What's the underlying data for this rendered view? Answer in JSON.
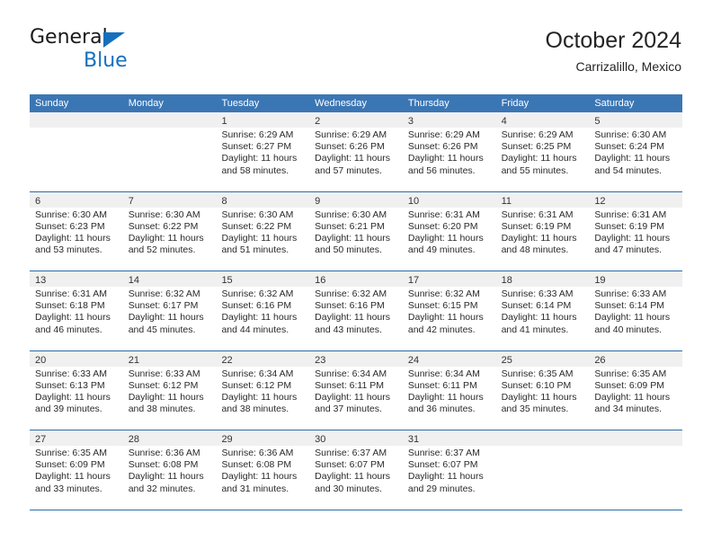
{
  "logo": {
    "word_one": "General",
    "word_two": "Blue",
    "triangle_color": "#1470bd",
    "text_color": "#1a1a1a"
  },
  "header": {
    "title": "October 2024",
    "subtitle": "Carrizalillo, Mexico"
  },
  "theme": {
    "header_blue": "#3b76b4",
    "separator_blue": "#2c6ba8",
    "date_band_gray": "#f0f0f0",
    "page_background": "#ffffff"
  },
  "calendar": {
    "weekdays": [
      "Sunday",
      "Monday",
      "Tuesday",
      "Wednesday",
      "Thursday",
      "Friday",
      "Saturday"
    ],
    "weeks": [
      [
        {
          "date": "",
          "sunrise": "",
          "sunset": "",
          "daylight_line1": "",
          "daylight_line2": ""
        },
        {
          "date": "",
          "sunrise": "",
          "sunset": "",
          "daylight_line1": "",
          "daylight_line2": ""
        },
        {
          "date": "1",
          "sunrise": "Sunrise: 6:29 AM",
          "sunset": "Sunset: 6:27 PM",
          "daylight_line1": "Daylight: 11 hours",
          "daylight_line2": "and 58 minutes."
        },
        {
          "date": "2",
          "sunrise": "Sunrise: 6:29 AM",
          "sunset": "Sunset: 6:26 PM",
          "daylight_line1": "Daylight: 11 hours",
          "daylight_line2": "and 57 minutes."
        },
        {
          "date": "3",
          "sunrise": "Sunrise: 6:29 AM",
          "sunset": "Sunset: 6:26 PM",
          "daylight_line1": "Daylight: 11 hours",
          "daylight_line2": "and 56 minutes."
        },
        {
          "date": "4",
          "sunrise": "Sunrise: 6:29 AM",
          "sunset": "Sunset: 6:25 PM",
          "daylight_line1": "Daylight: 11 hours",
          "daylight_line2": "and 55 minutes."
        },
        {
          "date": "5",
          "sunrise": "Sunrise: 6:30 AM",
          "sunset": "Sunset: 6:24 PM",
          "daylight_line1": "Daylight: 11 hours",
          "daylight_line2": "and 54 minutes."
        }
      ],
      [
        {
          "date": "6",
          "sunrise": "Sunrise: 6:30 AM",
          "sunset": "Sunset: 6:23 PM",
          "daylight_line1": "Daylight: 11 hours",
          "daylight_line2": "and 53 minutes."
        },
        {
          "date": "7",
          "sunrise": "Sunrise: 6:30 AM",
          "sunset": "Sunset: 6:22 PM",
          "daylight_line1": "Daylight: 11 hours",
          "daylight_line2": "and 52 minutes."
        },
        {
          "date": "8",
          "sunrise": "Sunrise: 6:30 AM",
          "sunset": "Sunset: 6:22 PM",
          "daylight_line1": "Daylight: 11 hours",
          "daylight_line2": "and 51 minutes."
        },
        {
          "date": "9",
          "sunrise": "Sunrise: 6:30 AM",
          "sunset": "Sunset: 6:21 PM",
          "daylight_line1": "Daylight: 11 hours",
          "daylight_line2": "and 50 minutes."
        },
        {
          "date": "10",
          "sunrise": "Sunrise: 6:31 AM",
          "sunset": "Sunset: 6:20 PM",
          "daylight_line1": "Daylight: 11 hours",
          "daylight_line2": "and 49 minutes."
        },
        {
          "date": "11",
          "sunrise": "Sunrise: 6:31 AM",
          "sunset": "Sunset: 6:19 PM",
          "daylight_line1": "Daylight: 11 hours",
          "daylight_line2": "and 48 minutes."
        },
        {
          "date": "12",
          "sunrise": "Sunrise: 6:31 AM",
          "sunset": "Sunset: 6:19 PM",
          "daylight_line1": "Daylight: 11 hours",
          "daylight_line2": "and 47 minutes."
        }
      ],
      [
        {
          "date": "13",
          "sunrise": "Sunrise: 6:31 AM",
          "sunset": "Sunset: 6:18 PM",
          "daylight_line1": "Daylight: 11 hours",
          "daylight_line2": "and 46 minutes."
        },
        {
          "date": "14",
          "sunrise": "Sunrise: 6:32 AM",
          "sunset": "Sunset: 6:17 PM",
          "daylight_line1": "Daylight: 11 hours",
          "daylight_line2": "and 45 minutes."
        },
        {
          "date": "15",
          "sunrise": "Sunrise: 6:32 AM",
          "sunset": "Sunset: 6:16 PM",
          "daylight_line1": "Daylight: 11 hours",
          "daylight_line2": "and 44 minutes."
        },
        {
          "date": "16",
          "sunrise": "Sunrise: 6:32 AM",
          "sunset": "Sunset: 6:16 PM",
          "daylight_line1": "Daylight: 11 hours",
          "daylight_line2": "and 43 minutes."
        },
        {
          "date": "17",
          "sunrise": "Sunrise: 6:32 AM",
          "sunset": "Sunset: 6:15 PM",
          "daylight_line1": "Daylight: 11 hours",
          "daylight_line2": "and 42 minutes."
        },
        {
          "date": "18",
          "sunrise": "Sunrise: 6:33 AM",
          "sunset": "Sunset: 6:14 PM",
          "daylight_line1": "Daylight: 11 hours",
          "daylight_line2": "and 41 minutes."
        },
        {
          "date": "19",
          "sunrise": "Sunrise: 6:33 AM",
          "sunset": "Sunset: 6:14 PM",
          "daylight_line1": "Daylight: 11 hours",
          "daylight_line2": "and 40 minutes."
        }
      ],
      [
        {
          "date": "20",
          "sunrise": "Sunrise: 6:33 AM",
          "sunset": "Sunset: 6:13 PM",
          "daylight_line1": "Daylight: 11 hours",
          "daylight_line2": "and 39 minutes."
        },
        {
          "date": "21",
          "sunrise": "Sunrise: 6:33 AM",
          "sunset": "Sunset: 6:12 PM",
          "daylight_line1": "Daylight: 11 hours",
          "daylight_line2": "and 38 minutes."
        },
        {
          "date": "22",
          "sunrise": "Sunrise: 6:34 AM",
          "sunset": "Sunset: 6:12 PM",
          "daylight_line1": "Daylight: 11 hours",
          "daylight_line2": "and 38 minutes."
        },
        {
          "date": "23",
          "sunrise": "Sunrise: 6:34 AM",
          "sunset": "Sunset: 6:11 PM",
          "daylight_line1": "Daylight: 11 hours",
          "daylight_line2": "and 37 minutes."
        },
        {
          "date": "24",
          "sunrise": "Sunrise: 6:34 AM",
          "sunset": "Sunset: 6:11 PM",
          "daylight_line1": "Daylight: 11 hours",
          "daylight_line2": "and 36 minutes."
        },
        {
          "date": "25",
          "sunrise": "Sunrise: 6:35 AM",
          "sunset": "Sunset: 6:10 PM",
          "daylight_line1": "Daylight: 11 hours",
          "daylight_line2": "and 35 minutes."
        },
        {
          "date": "26",
          "sunrise": "Sunrise: 6:35 AM",
          "sunset": "Sunset: 6:09 PM",
          "daylight_line1": "Daylight: 11 hours",
          "daylight_line2": "and 34 minutes."
        }
      ],
      [
        {
          "date": "27",
          "sunrise": "Sunrise: 6:35 AM",
          "sunset": "Sunset: 6:09 PM",
          "daylight_line1": "Daylight: 11 hours",
          "daylight_line2": "and 33 minutes."
        },
        {
          "date": "28",
          "sunrise": "Sunrise: 6:36 AM",
          "sunset": "Sunset: 6:08 PM",
          "daylight_line1": "Daylight: 11 hours",
          "daylight_line2": "and 32 minutes."
        },
        {
          "date": "29",
          "sunrise": "Sunrise: 6:36 AM",
          "sunset": "Sunset: 6:08 PM",
          "daylight_line1": "Daylight: 11 hours",
          "daylight_line2": "and 31 minutes."
        },
        {
          "date": "30",
          "sunrise": "Sunrise: 6:37 AM",
          "sunset": "Sunset: 6:07 PM",
          "daylight_line1": "Daylight: 11 hours",
          "daylight_line2": "and 30 minutes."
        },
        {
          "date": "31",
          "sunrise": "Sunrise: 6:37 AM",
          "sunset": "Sunset: 6:07 PM",
          "daylight_line1": "Daylight: 11 hours",
          "daylight_line2": "and 29 minutes."
        },
        {
          "date": "",
          "sunrise": "",
          "sunset": "",
          "daylight_line1": "",
          "daylight_line2": ""
        },
        {
          "date": "",
          "sunrise": "",
          "sunset": "",
          "daylight_line1": "",
          "daylight_line2": ""
        }
      ]
    ]
  }
}
